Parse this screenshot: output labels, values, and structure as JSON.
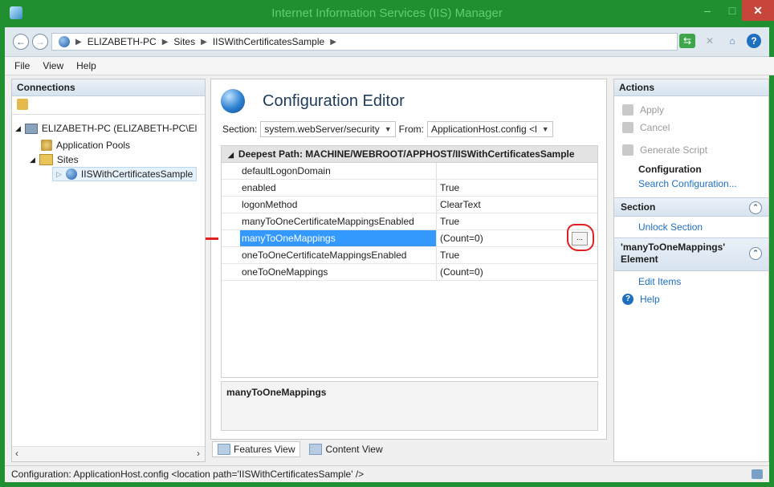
{
  "window": {
    "title": "Internet Information Services (IIS) Manager",
    "min": "–",
    "max": "□",
    "close": "✕"
  },
  "address": {
    "crumbs": [
      "ELIZABETH-PC",
      "Sites",
      "IISWithCertificatesSample"
    ]
  },
  "menu": [
    "File",
    "View",
    "Help"
  ],
  "connections": {
    "header": "Connections",
    "tree": [
      {
        "label": "ELIZABETH-PC (ELIZABETH-PC\\El"
      },
      {
        "label": "Application Pools"
      },
      {
        "label": "Sites"
      },
      {
        "label": "IISWithCertificatesSample"
      }
    ]
  },
  "editor": {
    "title": "Configuration Editor",
    "section_label": "Section:",
    "section_value": "system.webServer/security",
    "from_label": "From:",
    "from_value": "ApplicationHost.config <l",
    "grid_header": "Deepest Path: MACHINE/WEBROOT/APPHOST/IISWithCertificatesSample",
    "rows": [
      {
        "name": "defaultLogonDomain",
        "value": ""
      },
      {
        "name": "enabled",
        "value": "True"
      },
      {
        "name": "logonMethod",
        "value": "ClearText"
      },
      {
        "name": "manyToOneCertificateMappingsEnabled",
        "value": "True"
      },
      {
        "name": "manyToOneMappings",
        "value": "(Count=0)"
      },
      {
        "name": "oneToOneCertificateMappingsEnabled",
        "value": "True"
      },
      {
        "name": "oneToOneMappings",
        "value": "(Count=0)"
      }
    ],
    "ellipsis": "...",
    "description": "manyToOneMappings",
    "view_tabs": [
      "Features View",
      "Content View"
    ]
  },
  "actions": {
    "header": "Actions",
    "apply": "Apply",
    "cancel": "Cancel",
    "generate_script": "Generate Script",
    "configuration_heading": "Configuration",
    "search_configuration": "Search Configuration...",
    "section_header": "Section",
    "unlock_section": "Unlock Section",
    "element_header_line1": "'manyToOneMappings'",
    "element_header_line2": "Element",
    "edit_items": "Edit Items",
    "help": "Help"
  },
  "status": {
    "text": "Configuration: ApplicationHost.config <location path='IISWithCertificatesSample' />"
  },
  "colors": {
    "title_bar": "#1f8f2f",
    "selection": "#3399ff",
    "link": "#1f6fbf",
    "annotation": "#e02020"
  }
}
